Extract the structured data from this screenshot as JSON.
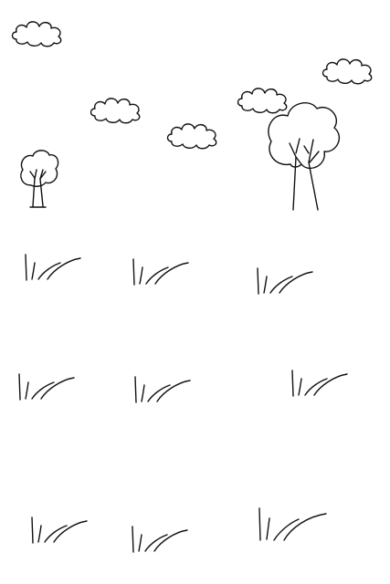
{
  "scene": {
    "background_color": "#ffffff",
    "line_color": "#111111",
    "clouds": [
      {
        "name": "cloud-1"
      },
      {
        "name": "cloud-2"
      },
      {
        "name": "cloud-3"
      },
      {
        "name": "cloud-4"
      },
      {
        "name": "cloud-5"
      }
    ],
    "trees": [
      {
        "name": "tree-small"
      },
      {
        "name": "tree-large"
      }
    ],
    "grass_tufts_count": 9
  }
}
